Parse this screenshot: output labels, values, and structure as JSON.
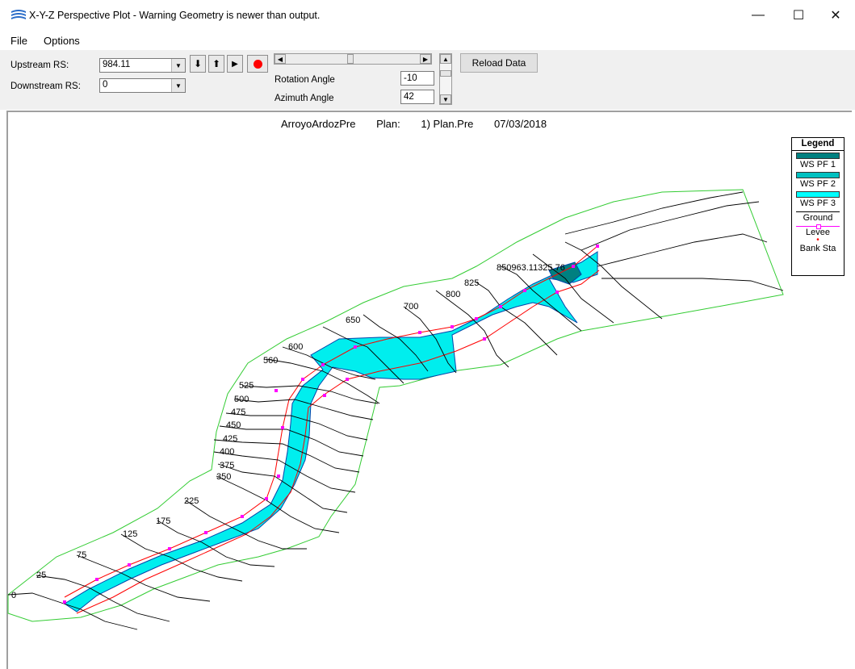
{
  "window": {
    "title": "X-Y-Z Perspective Plot - Warning Geometry is newer than output.",
    "minimize": "—",
    "maximize": "☐",
    "close": "✕"
  },
  "menu": [
    "File",
    "Options"
  ],
  "toolbar": {
    "upstream_label": "Upstream RS:",
    "upstream_value": "984.11",
    "downstream_label": "Downstream RS:",
    "downstream_value": "0",
    "rotation_label": "Rotation Angle",
    "rotation_value": "-10",
    "azimuth_label": "Azimuth Angle",
    "azimuth_value": "42",
    "reload_label": "Reload Data"
  },
  "plot": {
    "river": "ArroyoArdozPre",
    "plan_label": "Plan:",
    "plan_name": "1) Plan.Pre",
    "date": "07/03/2018",
    "station_labels": [
      "0",
      "25",
      "75",
      "125",
      "175",
      "225",
      "350",
      "375",
      "400",
      "425",
      "450",
      "475",
      "500",
      "525",
      "560",
      "600",
      "650",
      "700",
      "800",
      "825",
      "850963.11325.76"
    ]
  },
  "legend": {
    "title": "Legend",
    "items": [
      "WS PF 1",
      "WS PF 2",
      "WS PF 3",
      "Ground",
      "Levee",
      "Bank Sta"
    ],
    "colors": {
      "ws_pf1": "#008080",
      "ws_pf2": "#00c0c0",
      "ws_pf3": "#00ffff",
      "ground": "#000000",
      "levee": "#ff00ff",
      "bank_sta": "#ff0000",
      "boundary": "#33cc33"
    }
  }
}
